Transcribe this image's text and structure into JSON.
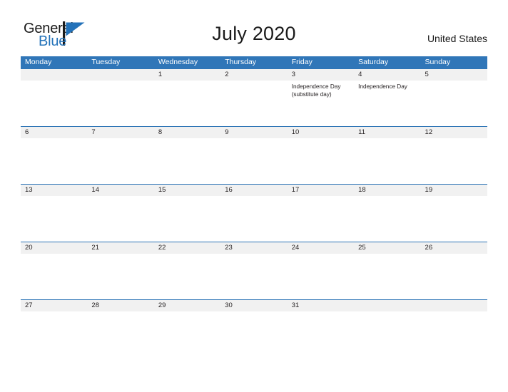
{
  "brand": {
    "name_part1": "General",
    "name_part2": "Blue",
    "flag_icon": "flag-triangle-icon",
    "colors": {
      "dark": "#1a1a1a",
      "blue": "#2372b9"
    }
  },
  "header": {
    "title": "July 2020",
    "country": "United States"
  },
  "theme": {
    "header_blue": "#3076b8",
    "row_border_blue": "#2e75b6",
    "date_band_grey": "#f1f1f1",
    "text_dark": "#231f20",
    "page_background": "#ffffff"
  },
  "calendar": {
    "day_headers": [
      "Monday",
      "Tuesday",
      "Wednesday",
      "Thursday",
      "Friday",
      "Saturday",
      "Sunday"
    ],
    "weeks": [
      [
        {
          "day": "",
          "events": []
        },
        {
          "day": "",
          "events": []
        },
        {
          "day": "1",
          "events": []
        },
        {
          "day": "2",
          "events": []
        },
        {
          "day": "3",
          "events": [
            "Independence Day (substitute day)"
          ]
        },
        {
          "day": "4",
          "events": [
            "Independence Day"
          ]
        },
        {
          "day": "5",
          "events": []
        }
      ],
      [
        {
          "day": "6",
          "events": []
        },
        {
          "day": "7",
          "events": []
        },
        {
          "day": "8",
          "events": []
        },
        {
          "day": "9",
          "events": []
        },
        {
          "day": "10",
          "events": []
        },
        {
          "day": "11",
          "events": []
        },
        {
          "day": "12",
          "events": []
        }
      ],
      [
        {
          "day": "13",
          "events": []
        },
        {
          "day": "14",
          "events": []
        },
        {
          "day": "15",
          "events": []
        },
        {
          "day": "16",
          "events": []
        },
        {
          "day": "17",
          "events": []
        },
        {
          "day": "18",
          "events": []
        },
        {
          "day": "19",
          "events": []
        }
      ],
      [
        {
          "day": "20",
          "events": []
        },
        {
          "day": "21",
          "events": []
        },
        {
          "day": "22",
          "events": []
        },
        {
          "day": "23",
          "events": []
        },
        {
          "day": "24",
          "events": []
        },
        {
          "day": "25",
          "events": []
        },
        {
          "day": "26",
          "events": []
        }
      ],
      [
        {
          "day": "27",
          "events": []
        },
        {
          "day": "28",
          "events": []
        },
        {
          "day": "29",
          "events": []
        },
        {
          "day": "30",
          "events": []
        },
        {
          "day": "31",
          "events": []
        },
        {
          "day": "",
          "events": []
        },
        {
          "day": "",
          "events": []
        }
      ]
    ]
  }
}
